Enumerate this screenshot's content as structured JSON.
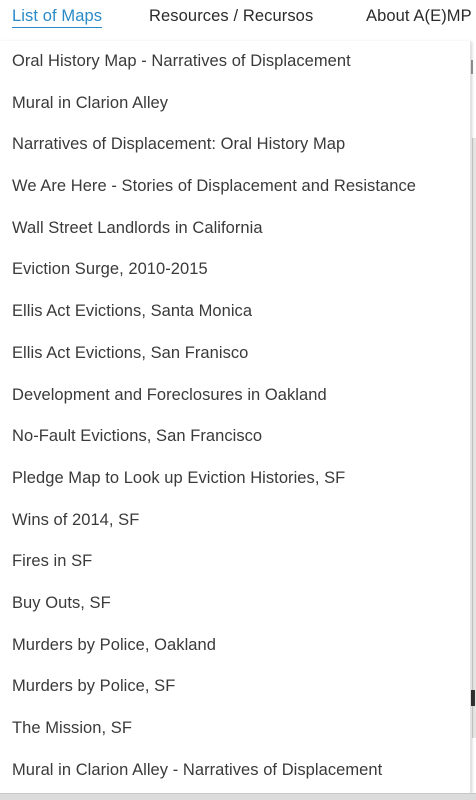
{
  "nav": {
    "items": [
      {
        "label": "List of Maps",
        "active": true
      },
      {
        "label": "Resources / Recursos",
        "active": false
      },
      {
        "label": "About A(E)MP",
        "active": false
      }
    ]
  },
  "dropdown": {
    "items": [
      "Oral History Map - Narratives of Displacement",
      "Mural in Clarion Alley",
      "Narratives of Displacement: Oral History Map",
      "We Are Here - Stories of Displacement and Resistance",
      "Wall Street Landlords in California",
      "Eviction Surge, 2010-2015",
      "Ellis Act Evictions, Santa Monica",
      "Ellis Act Evictions, San Franisco",
      "Development and Foreclosures in Oakland",
      "No-Fault Evictions, San Francisco",
      "Pledge Map to Look up Eviction Histories, SF",
      "Wins of 2014, SF",
      "Fires in SF",
      "Buy Outs, SF",
      "Murders by Police, Oakland",
      "Murders by Police, SF",
      "The Mission, SF",
      "Mural in Clarion Alley - Narratives of Displacement"
    ]
  },
  "colors": {
    "accent": "#2a8bc8",
    "text": "#3a3a3a"
  }
}
